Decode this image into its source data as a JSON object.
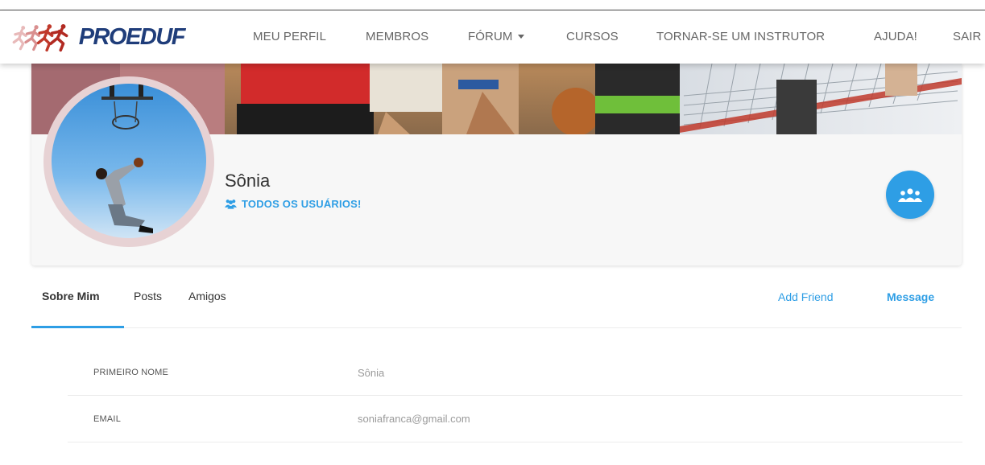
{
  "brand": {
    "logo_text": "PROEDUF",
    "logo_icon": "runners-logo-icon"
  },
  "nav": {
    "items": [
      {
        "label": "MEU PERFIL"
      },
      {
        "label": "MEMBROS"
      },
      {
        "label": "FÓRUM"
      },
      {
        "label": "CURSOS"
      },
      {
        "label": "TORNAR-SE UM INSTRUTOR"
      },
      {
        "label": "AJUDA!"
      },
      {
        "label": "SAIR"
      }
    ],
    "forum_has_dropdown": true
  },
  "profile": {
    "name": "Sônia",
    "group_label": "TODOS OS USUÁRIOS!",
    "group_icon": "users-icon",
    "group_button_icon": "group-icon"
  },
  "tabs": {
    "items": [
      {
        "label": "Sobre Mim",
        "active": true
      },
      {
        "label": "Posts",
        "active": false
      },
      {
        "label": "Amigos",
        "active": false
      }
    ],
    "actions": {
      "add_friend": "Add Friend",
      "message": "Message"
    }
  },
  "about": {
    "rows": [
      {
        "label": "PRIMEIRO NOME",
        "value": "Sônia"
      },
      {
        "label": "EMAIL",
        "value": "soniafranca@gmail.com"
      }
    ]
  },
  "colors": {
    "accent": "#2e9ee5",
    "logo": "#1f3d7a",
    "logo_runners": "#c0392b"
  }
}
